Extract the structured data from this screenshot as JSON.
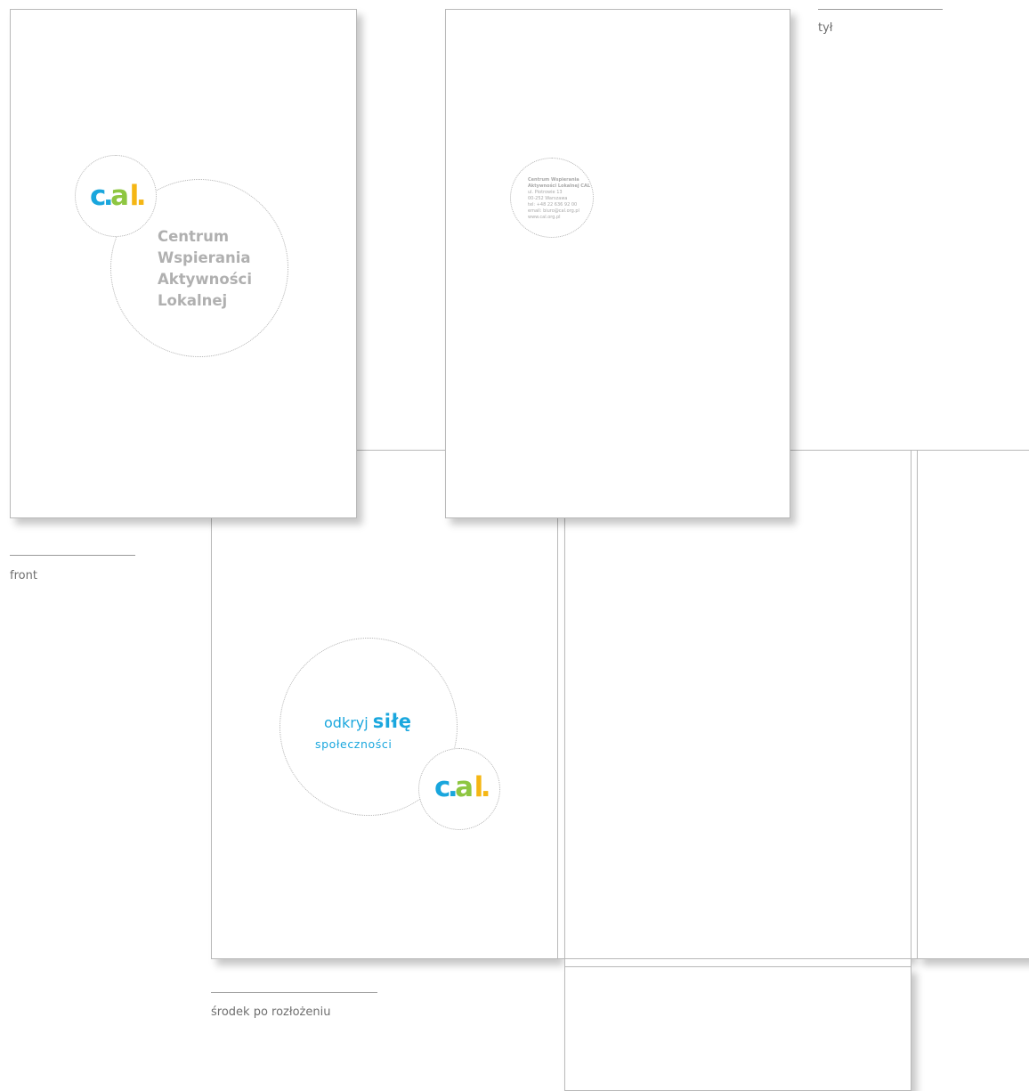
{
  "captions": {
    "front": "front",
    "back": "tył",
    "inside": "środek po rozłożeniu"
  },
  "logo": {
    "letters": [
      "c",
      ".",
      "a",
      "l",
      "."
    ],
    "colors": {
      "c": "#19a6dd",
      "dot1": "#19a6dd",
      "a": "#8ec641",
      "l": "#f5b614",
      "dot2": "#f5b614"
    }
  },
  "front_cover": {
    "title_lines": [
      "Centrum",
      "Wspierania",
      "Aktywności",
      "Lokalnej"
    ]
  },
  "back_cover": {
    "address_lines": [
      "Centrum Wspierania",
      "Aktywności Lokalnej CAL",
      "ul. Piotrowie 13",
      "00-252 Warszawa",
      "tel: +48 22 636 92 00",
      "email: biuro@cal.org.pl",
      "www.cal.org.pl"
    ]
  },
  "inside": {
    "slogan_prefix": "odkryj",
    "slogan_accent": "siłę",
    "slogan_line2": "społeczności"
  }
}
